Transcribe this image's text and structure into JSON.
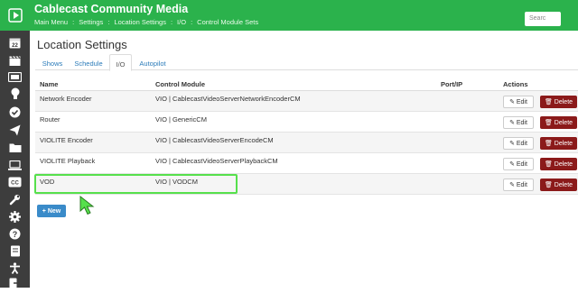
{
  "header": {
    "brand": "Cablecast Community Media",
    "search_placeholder": "Searc"
  },
  "breadcrumb": [
    "Main Menu",
    "Settings",
    "Location Settings",
    "I/O",
    "Control Module Sets"
  ],
  "page": {
    "title": "Location Settings"
  },
  "tabs": [
    "Shows",
    "Schedule",
    "I/O",
    "Autopilot"
  ],
  "active_tab": "I/O",
  "table": {
    "headers": [
      "Name",
      "Control Module",
      "Port/IP",
      "Actions"
    ],
    "rows": [
      {
        "name": "Network Encoder",
        "module": "VIO | CablecastVideoServerNetworkEncoderCM",
        "port": ""
      },
      {
        "name": "Router",
        "module": "VIO | GenericCM",
        "port": ""
      },
      {
        "name": "VIOLITE Encoder",
        "module": "VIO | CablecastVideoServerEncodeCM",
        "port": ""
      },
      {
        "name": "VIOLITE Playback",
        "module": "VIO | CablecastVideoServerPlaybackCM",
        "port": ""
      },
      {
        "name": "VOD",
        "module": "VIO | VODCM",
        "port": ""
      }
    ],
    "edit_label": "Edit",
    "delete_label": "Delete"
  },
  "new_button": "New",
  "colors": {
    "brand_green": "#2bb24c",
    "sidebar": "#3d3d3d",
    "link_blue": "#2b7bb9",
    "delete_red": "#8b1a1a",
    "new_blue": "#3a8bc9",
    "highlight": "#56e04c"
  },
  "sidebar_icons": [
    "cablecast-logo-icon",
    "calendar-icon",
    "clapperboard-icon",
    "video-device-icon",
    "lightbulb-icon",
    "check-circle-icon",
    "send-icon",
    "folder-icon",
    "laptop-icon",
    "closed-captions-icon",
    "wrench-icon",
    "gear-icon",
    "help-icon",
    "book-icon",
    "accessibility-icon",
    "sign-out-icon"
  ]
}
